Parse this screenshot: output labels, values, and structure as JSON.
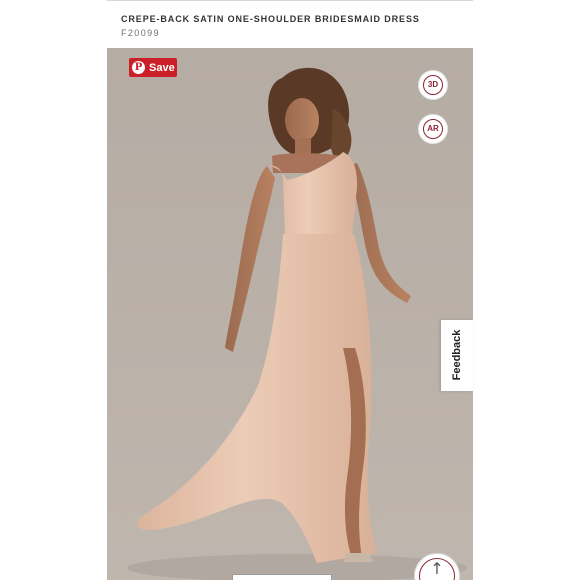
{
  "product": {
    "title": "CREPE-BACK SATIN ONE-SHOULDER BRIDESMAID DRESS",
    "sku": "F20099"
  },
  "photo": {
    "background_color": "#b8afa7",
    "dress_color": "#e9c6b0"
  },
  "pinterest": {
    "save_label": "Save",
    "icon": "pinterest-icon",
    "color": "#cb2027"
  },
  "viewer": {
    "three_d_label": "3D",
    "ar_label": "AR",
    "accent_color": "#8a2432"
  },
  "feedback": {
    "label": "Feedback"
  },
  "scroll_top": {
    "icon": "arrow-up-icon",
    "glyph": "↑"
  }
}
